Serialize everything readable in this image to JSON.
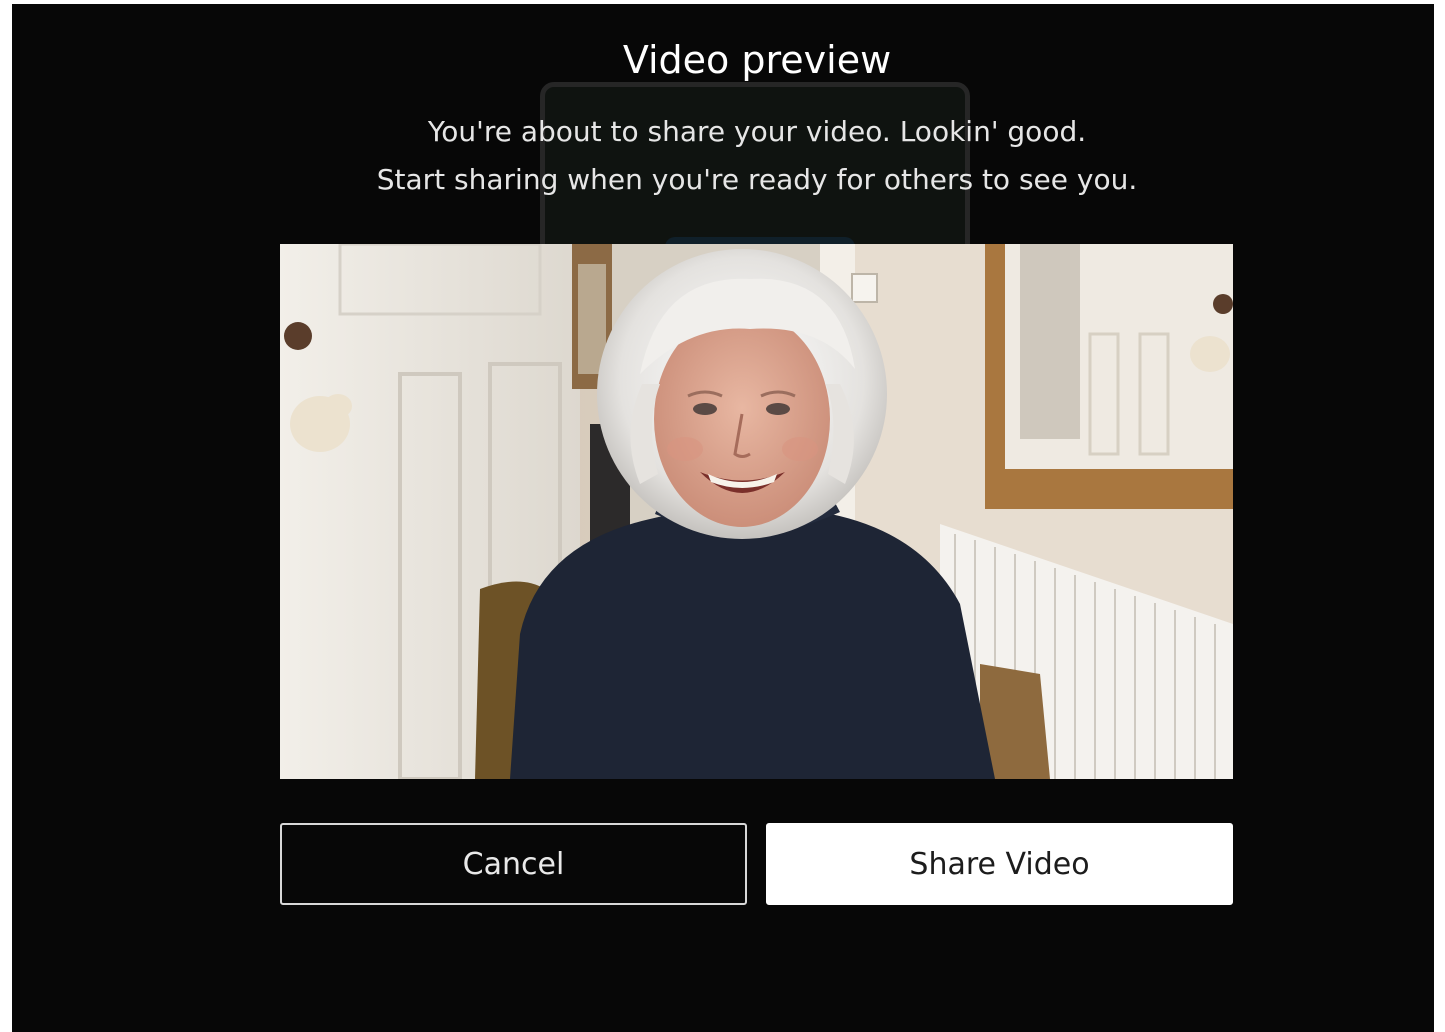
{
  "dialog": {
    "title": "Video preview",
    "message_line1": "You're about to share your video. Lookin' good.",
    "message_line2": "Start sharing when you're ready for others to see you."
  },
  "video_preview": {
    "icon": "camera-preview-image"
  },
  "actions": {
    "cancel_label": "Cancel",
    "share_label": "Share Video"
  },
  "colors": {
    "background": "#070707",
    "primary_button_bg": "#ffffff",
    "primary_button_text": "#1c1c1c",
    "secondary_button_border": "#d8d8d8"
  }
}
